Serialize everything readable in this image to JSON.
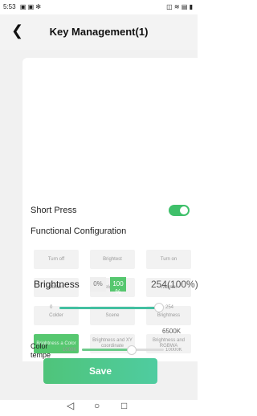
{
  "status_bar": {
    "time": "5:53",
    "left_icons": "▣ ▣ ✻",
    "right_icons": "◫ ≋ ▤ ▮"
  },
  "header": {
    "back": "❮",
    "title": "Key Management(1)"
  },
  "short_press": {
    "label": "Short Press",
    "enabled": true,
    "toggle_color": "#3fc06a"
  },
  "functional_configuration": {
    "label": "Functional Configuration",
    "options": [
      [
        "Turn off",
        "Brightest",
        "Turn on"
      ],
      [
        "Darken",
        "Brighten",
        "Warmer"
      ],
      [
        "Colder",
        "Scene",
        "Brightness"
      ],
      [
        "Brightness a Color",
        "Brightness and XY coordinate",
        "Brightness and RGBWA"
      ]
    ],
    "selected": "Brightness a Color"
  },
  "brightness": {
    "label": "Brightness",
    "mode_0": "0%",
    "mode_100": "100 %",
    "readout": "254(100%)",
    "min_label": "0",
    "max_label": "254",
    "value": 254,
    "max": 254
  },
  "color_temp": {
    "label": "Color tempe",
    "readout": "6500K",
    "min_label": "1000K",
    "max_label": "10000K",
    "value": 6500,
    "min": 1000,
    "max": 10000
  },
  "save": {
    "label": "Save"
  },
  "navbar": {
    "back": "◁",
    "home": "○",
    "recents": "□"
  },
  "colors": {
    "accent_green": "#56c76f",
    "slider": "#43c0a1"
  }
}
